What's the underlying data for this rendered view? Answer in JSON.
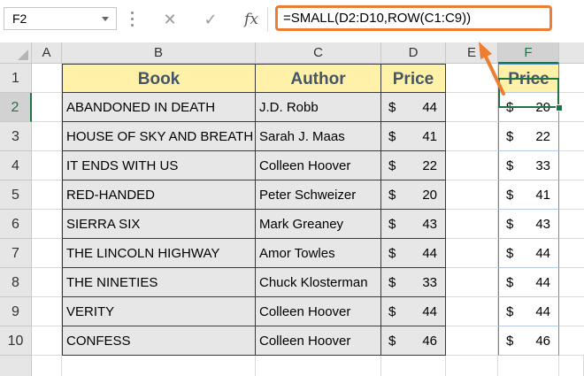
{
  "toolbar": {
    "name_box": "F2",
    "cancel_icon": "✕",
    "enter_icon": "✓",
    "fx_label": "fx",
    "formula": "=SMALL(D2:D10,ROW(C1:C9))"
  },
  "columns": [
    "A",
    "B",
    "C",
    "D",
    "E",
    "F"
  ],
  "rows": [
    "1",
    "2",
    "3",
    "4",
    "5",
    "6",
    "7",
    "8",
    "9",
    "10"
  ],
  "table": {
    "headers": {
      "book": "Book",
      "author": "Author",
      "price": "Price"
    },
    "rows": [
      {
        "book": "ABANDONED IN DEATH",
        "author": "J.D. Robb",
        "currency": "$",
        "price": "44"
      },
      {
        "book": "HOUSE OF SKY AND BREATH",
        "author": "Sarah J. Maas",
        "currency": "$",
        "price": "41"
      },
      {
        "book": "IT ENDS WITH US",
        "author": "Colleen Hoover",
        "currency": "$",
        "price": "22"
      },
      {
        "book": "RED-HANDED",
        "author": "Peter Schweizer",
        "currency": "$",
        "price": "20"
      },
      {
        "book": "SIERRA SIX",
        "author": "Mark Greaney",
        "currency": "$",
        "price": "43"
      },
      {
        "book": "THE LINCOLN HIGHWAY",
        "author": "Amor Towles",
        "currency": "$",
        "price": "44"
      },
      {
        "book": "THE NINETIES",
        "author": "Chuck Klosterman",
        "currency": "$",
        "price": "33"
      },
      {
        "book": "VERITY",
        "author": "Colleen Hoover",
        "currency": "$",
        "price": "44"
      },
      {
        "book": "CONFESS",
        "author": "Colleen Hoover",
        "currency": "$",
        "price": "46"
      }
    ]
  },
  "result": {
    "header": "Price",
    "currency": "$",
    "values": [
      "20",
      "22",
      "33",
      "41",
      "43",
      "44",
      "44",
      "44",
      "46"
    ]
  },
  "colors": {
    "accent_orange": "#ED7D31",
    "header_fill": "#FFF2A8",
    "selection_green": "#217346"
  }
}
